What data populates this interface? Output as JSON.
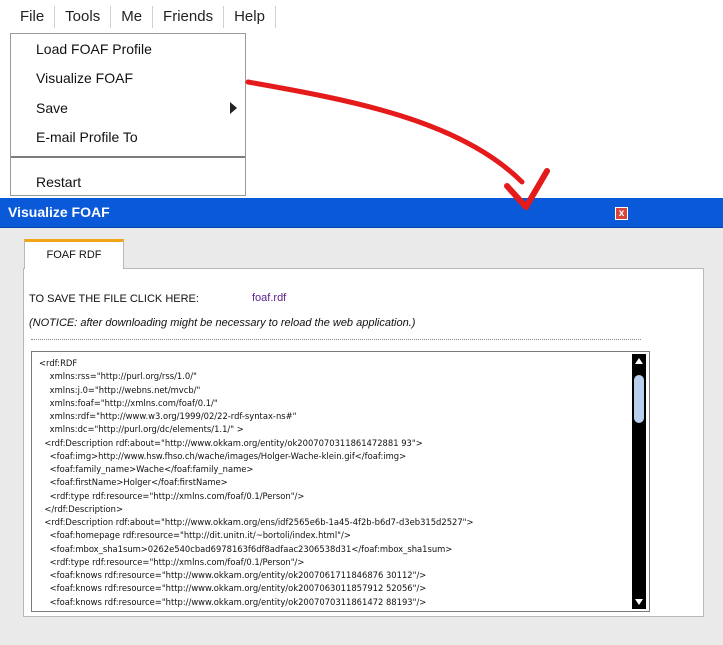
{
  "menubar": {
    "items": [
      "File",
      "Tools",
      "Me",
      "Friends",
      "Help"
    ]
  },
  "dropdown": {
    "items": [
      "Load FOAF Profile",
      "Visualize FOAF",
      "Save",
      "E-mail Profile To",
      "Restart"
    ]
  },
  "window": {
    "title": "Visualize FOAF",
    "close_label": "x",
    "tab_label": "FOAF RDF",
    "save_prompt": "TO SAVE THE FILE CLICK HERE:",
    "save_link": "foaf.rdf",
    "notice": "(NOTICE: after downloading might be necessary to reload the web application.)"
  },
  "code": {
    "lines": [
      "<rdf:RDF",
      "    xmlns:rss=\"http://purl.org/rss/1.0/\"",
      "    xmlns:j.0=\"http://webns.net/mvcb/\"",
      "    xmlns:foaf=\"http://xmlns.com/foaf/0.1/\"",
      "    xmlns:rdf=\"http://www.w3.org/1999/02/22-rdf-syntax-ns#\"",
      "    xmlns:dc=\"http://purl.org/dc/elements/1.1/\" >",
      "  <rdf:Description rdf:about=\"http://www.okkam.org/entity/ok2007070311861472881 93\">",
      "    <foaf:img>http://www.hsw.fhso.ch/wache/images/Holger-Wache-klein.gif</foaf:img>",
      "    <foaf:family_name>Wache</foaf:family_name>",
      "    <foaf:firstName>Holger</foaf:firstName>",
      "    <rdf:type rdf:resource=\"http://xmlns.com/foaf/0.1/Person\"/>",
      "  </rdf:Description>",
      "  <rdf:Description rdf:about=\"http://www.okkam.org/ens/idf2565e6b-1a45-4f2b-b6d7-d3eb315d2527\">",
      "    <foaf:homepage rdf:resource=\"http://dit.unitn.it/~bortoli/index.html\"/>",
      "    <foaf:mbox_sha1sum>0262e540cbad6978163f6df8adfaac2306538d31</foaf:mbox_sha1sum>",
      "    <rdf:type rdf:resource=\"http://xmlns.com/foaf/0.1/Person\"/>",
      "    <foaf:knows rdf:resource=\"http://www.okkam.org/entity/ok2007061711846876 30112\"/>",
      "    <foaf:knows rdf:resource=\"http://www.okkam.org/entity/ok2007063011857912 52056\"/>",
      "    <foaf:knows rdf:resource=\"http://www.okkam.org/entity/ok2007070311861472 88193\"/>"
    ]
  },
  "colors": {
    "titlebar": "#0a59d8",
    "tab_accent": "#f0a418",
    "arrow": "#e51a1a",
    "link": "#5a1f8f"
  }
}
